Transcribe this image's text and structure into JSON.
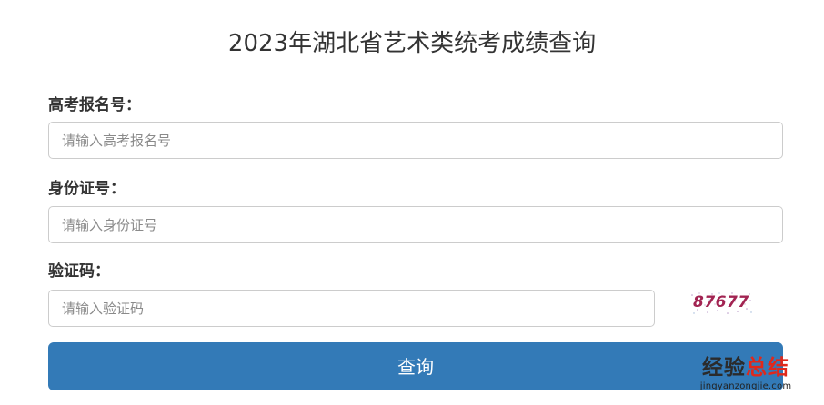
{
  "page": {
    "title": "2023年湖北省艺术类统考成绩查询"
  },
  "form": {
    "exam_number": {
      "label": "高考报名号：",
      "placeholder": "请输入高考报名号",
      "value": ""
    },
    "id_number": {
      "label": "身份证号：",
      "placeholder": "请输入身份证号",
      "value": ""
    },
    "captcha": {
      "label": "验证码：",
      "placeholder": "请输入验证码",
      "value": "",
      "image_text": "87677"
    },
    "submit_label": "查询"
  },
  "colors": {
    "primary_button": "#337ab7",
    "captcha_text": "#a22452"
  },
  "watermark": {
    "logo_text": "经验总结",
    "url_text": "jingyanzongjie.com"
  }
}
